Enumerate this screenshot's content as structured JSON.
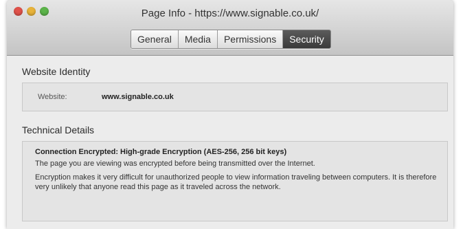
{
  "window": {
    "title": "Page Info - https://www.signable.co.uk/",
    "tabs": [
      {
        "label": "General",
        "active": false
      },
      {
        "label": "Media",
        "active": false
      },
      {
        "label": "Permissions",
        "active": false
      },
      {
        "label": "Security",
        "active": true
      }
    ]
  },
  "identity": {
    "section_title": "Website Identity",
    "website_label": "Website:",
    "website_value": "www.signable.co.uk"
  },
  "technical": {
    "section_title": "Technical Details",
    "heading": "Connection Encrypted: High-grade Encryption (AES-256, 256 bit keys)",
    "line1": "The page you are viewing was encrypted before being transmitted over the Internet.",
    "line2": "Encryption makes it very difficult for unauthorized people to view information traveling between computers. It is therefore very unlikely that anyone read this page as it traveled across the network."
  },
  "colors": {
    "traffic_close": "#e0524a",
    "traffic_min": "#e8b33a",
    "traffic_max": "#5cb44a",
    "active_tab": "#3a3a3a"
  }
}
